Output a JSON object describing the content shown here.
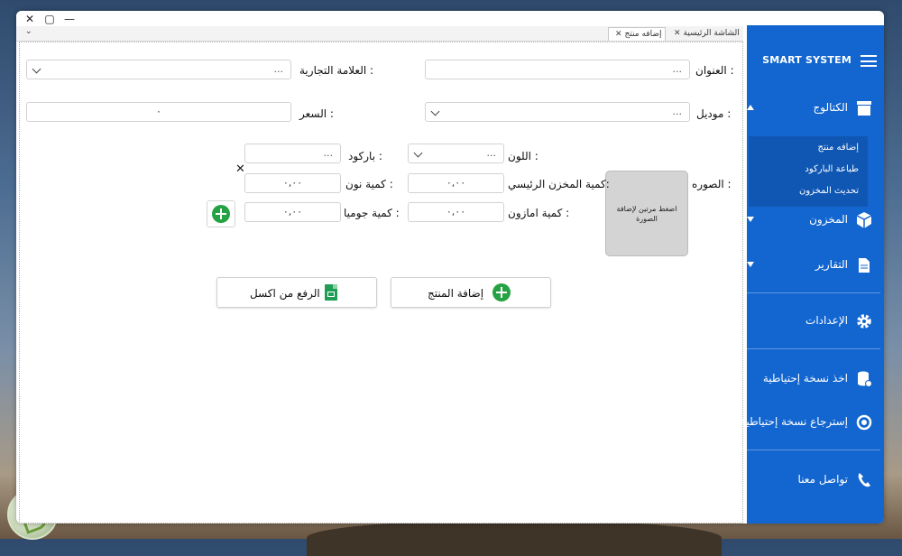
{
  "app": {
    "brand": "SMART SYSTEM"
  },
  "window_controls": {
    "close": "✕",
    "maximize": "▢",
    "minimize": "—"
  },
  "tabs": [
    {
      "label": "الشاشة الرئيسية",
      "close": "✕"
    },
    {
      "label": "إضافه منتج",
      "close": "✕",
      "active": true
    }
  ],
  "tab_dropdown": "⌄",
  "sidebar": {
    "catalog": {
      "label": "الكتالوج",
      "items": [
        "إضافه منتج",
        "طباعة الباركود",
        "تحديث المخزون"
      ]
    },
    "inventory": "المخزون",
    "reports": "التقارير",
    "settings": "الإعدادات",
    "backup": "اخذ نسخة إحتياطية",
    "restore": "إسترجاع نسخة إحتياطية",
    "contact": "تواصل معنا"
  },
  "form": {
    "title_label": "العنوان :",
    "title_placeholder": "...",
    "brand_label": "العلامة التجارية :",
    "brand_placeholder": "...",
    "model_label": "موديل :",
    "model_placeholder": "...",
    "price_label": "السعر :",
    "price_value": "٠",
    "image_label": "الصوره :",
    "image_hint": "اضغط مرتين لإضافة الصورة",
    "color_label": "اللون :",
    "color_placeholder": "...",
    "barcode_label": "باركود :",
    "barcode_placeholder": "...",
    "main_qty_label": "كمية المخزن الرئيسي:",
    "main_qty_value": "٠,٠٠",
    "noon_qty_label": "كمية نون :",
    "noon_qty_value": "٠,٠٠",
    "amazon_qty_label": "كمية امازون :",
    "amazon_qty_value": "٠,٠٠",
    "jumia_qty_label": "كمية جوميا :",
    "jumia_qty_value": "٠,٠٠",
    "clear_x": "✕"
  },
  "buttons": {
    "add_product": "إضافة المنتج",
    "upload_excel": "الرفع من اكسل"
  },
  "colors": {
    "sidebar": "#1366cf",
    "submenu": "#0f57b3",
    "add_green": "#25a244",
    "excel_green": "#1f9d55"
  }
}
